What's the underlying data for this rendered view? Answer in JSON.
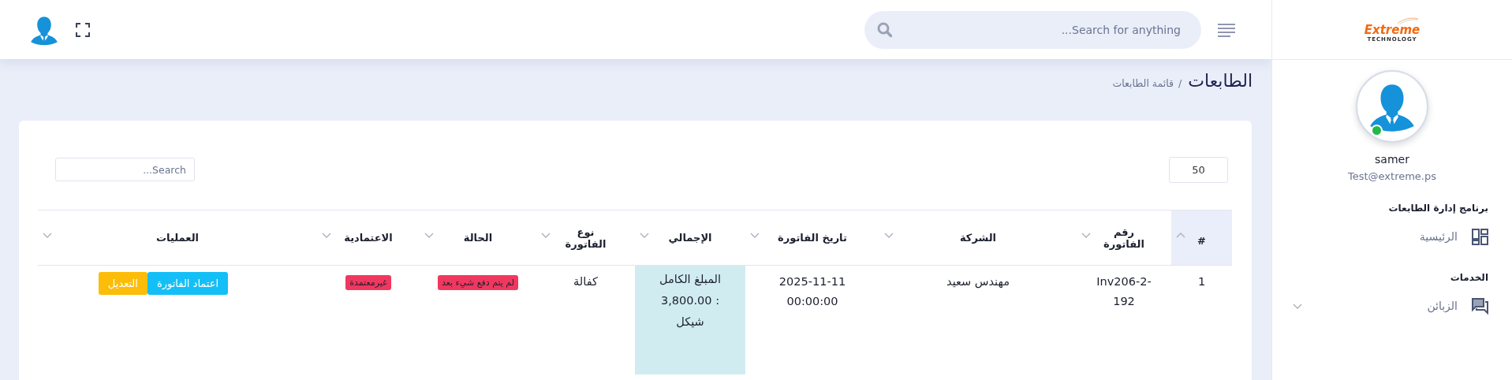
{
  "topbar": {
    "search": {
      "placeholder": "Search for anything..."
    }
  },
  "sidebar": {
    "logo": {
      "name": "Extreme",
      "tagline": "TECHNOLOGY"
    },
    "user": {
      "name": "samer",
      "email": "Test@extreme.ps",
      "online": true
    },
    "sections": [
      {
        "title": "برنامج إدارة الطابعات",
        "items": [
          {
            "label": "الرئيسية",
            "kind": "dashboard",
            "expandable": false
          }
        ]
      },
      {
        "title": "الخدمات",
        "items": [
          {
            "label": "الزبائن",
            "kind": "chat",
            "expandable": true
          }
        ]
      }
    ]
  },
  "page": {
    "title": "الطابعات",
    "separator": "/",
    "breadcrumb": "قائمة الطابعات"
  },
  "table_controls": {
    "page_size": "50",
    "search": {
      "placeholder": "Search..."
    }
  },
  "table": {
    "columns": [
      {
        "label": "#",
        "sorted": true
      },
      {
        "label": "رقم الفاتورة",
        "sorted": false
      },
      {
        "label": "الشركة",
        "sorted": false
      },
      {
        "label": "تاريخ الفاتورة",
        "sorted": false
      },
      {
        "label": "الإجمالي",
        "sorted": false
      },
      {
        "label": "نوع الفاتورة",
        "sorted": false
      },
      {
        "label": "الحالة",
        "sorted": false
      },
      {
        "label": "الاعتمادية",
        "sorted": false
      },
      {
        "label": "العمليات",
        "sorted": false
      }
    ],
    "rows": [
      {
        "cells": [
          {
            "kind": "text",
            "text": "1"
          },
          {
            "kind": "text",
            "text": "Inv206-2-192"
          },
          {
            "kind": "text",
            "text": "مهندس سعيد"
          },
          {
            "kind": "text",
            "text": "2025-11-11 00:00:00"
          },
          {
            "kind": "amount",
            "text": "المبلغ الكامل : 3,800.00 شيكل"
          },
          {
            "kind": "text",
            "text": "كفالة"
          },
          {
            "kind": "badge",
            "text": "لم يتم دفع شيء بعد"
          },
          {
            "kind": "badge",
            "text": "غيرمعتمدة"
          },
          {
            "kind": "actions",
            "buttons": [
              {
                "label": "اعتماد الفاتورة",
                "kind": "approve"
              },
              {
                "label": "التعديل",
                "kind": "edit"
              }
            ]
          }
        ]
      }
    ]
  }
}
